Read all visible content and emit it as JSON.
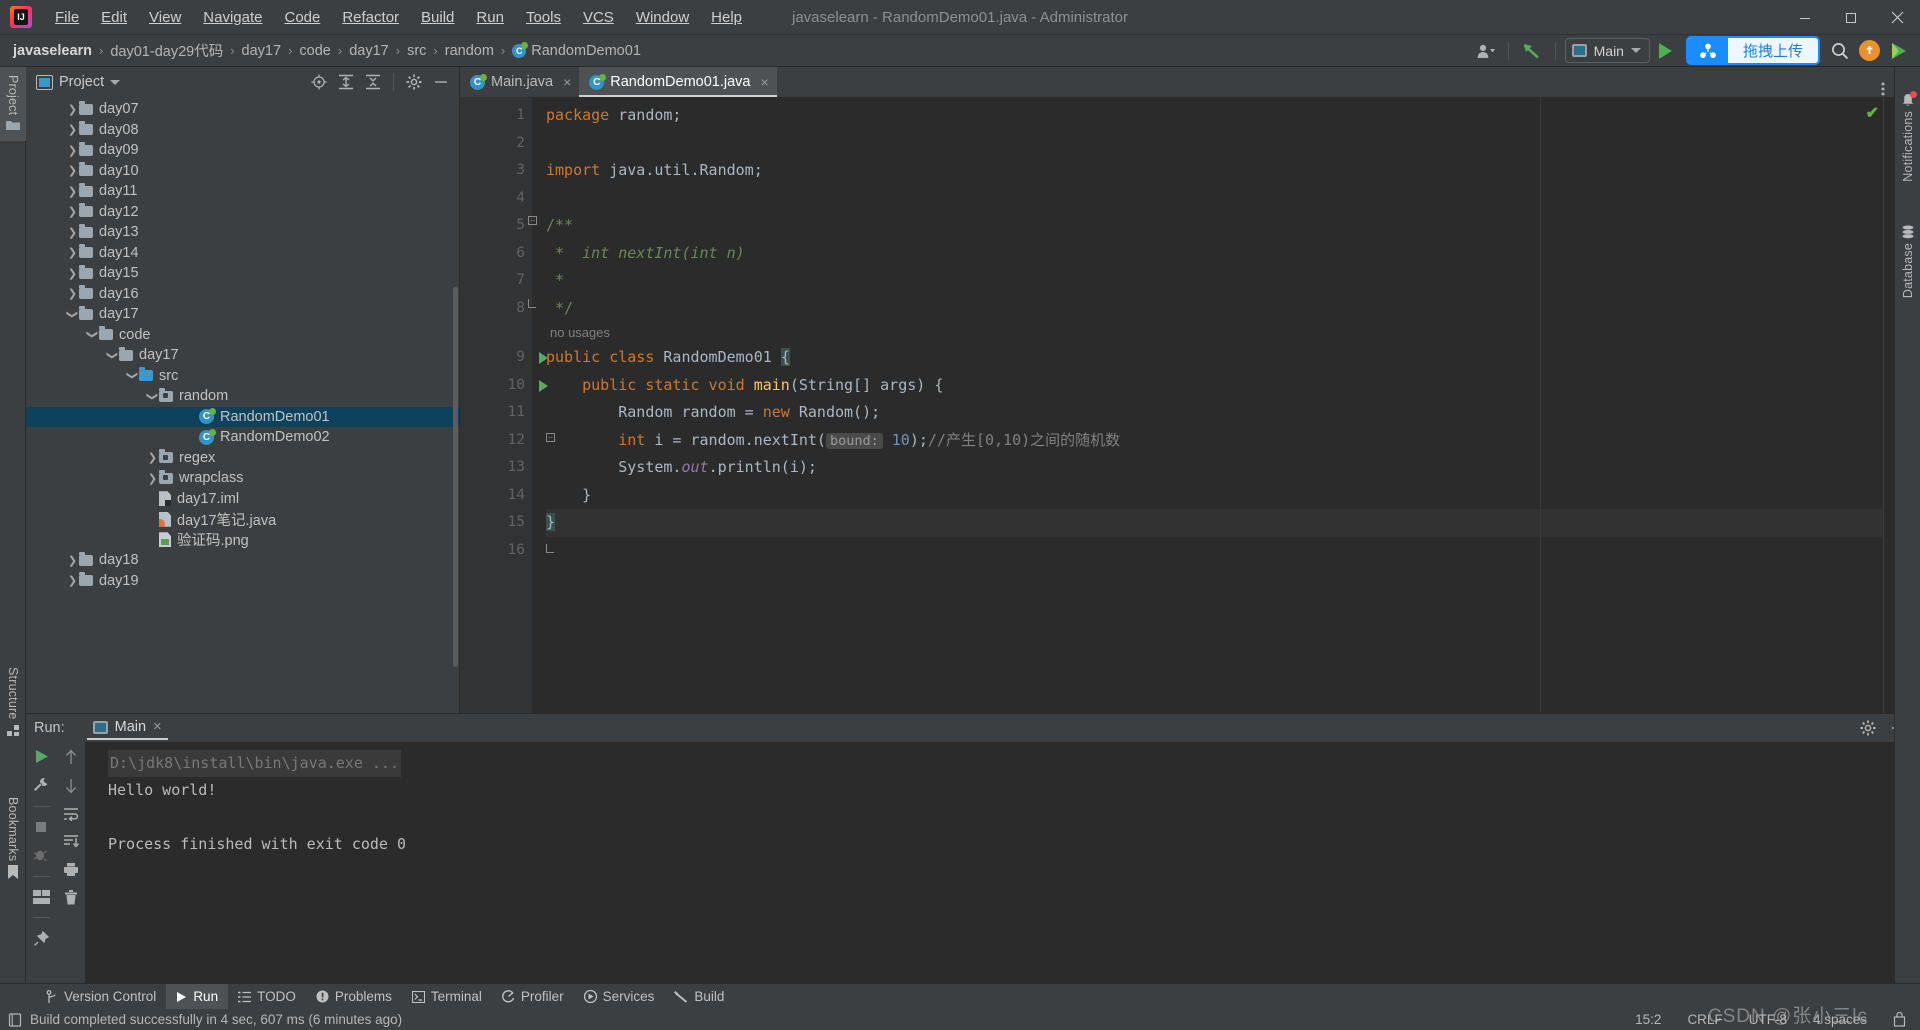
{
  "window": {
    "title": "javaselearn - RandomDemo01.java - Administrator",
    "minimize_label": "Minimize",
    "maximize_label": "Maximize",
    "close_label": "Close"
  },
  "menu": {
    "items": [
      {
        "label": "File",
        "mnemonic": "F"
      },
      {
        "label": "Edit",
        "mnemonic": "E"
      },
      {
        "label": "View",
        "mnemonic": "V"
      },
      {
        "label": "Navigate",
        "mnemonic": "N"
      },
      {
        "label": "Code",
        "mnemonic": "C"
      },
      {
        "label": "Refactor",
        "mnemonic": "R"
      },
      {
        "label": "Build",
        "mnemonic": "B"
      },
      {
        "label": "Run",
        "mnemonic": "u"
      },
      {
        "label": "Tools",
        "mnemonic": "T"
      },
      {
        "label": "VCS",
        "mnemonic": "S"
      },
      {
        "label": "Window",
        "mnemonic": "W"
      },
      {
        "label": "Help",
        "mnemonic": "H"
      }
    ]
  },
  "breadcrumb": {
    "items": [
      "javaselearn",
      "day01-day29代码",
      "day17",
      "code",
      "day17",
      "src",
      "random",
      "RandomDemo01"
    ],
    "separator": "›",
    "file_icon": "java-class-icon"
  },
  "toolbar": {
    "account_icon": "user-account-icon",
    "account_caret": "chevron-down-icon",
    "update_icon": "vcs-update-arrow-icon",
    "run_config": "Main",
    "run_config_caret": "chevron-down-icon",
    "run_button": "run-play-icon",
    "upload_label": "拖拽上传",
    "upload_icon": "cloud-share-icon",
    "search_icon": "search-icon",
    "notify_icon": "upload-arrow-icon",
    "ide_icon": "play-color-icon",
    "more_icon": "more-vertical-icon"
  },
  "left_strip": {
    "project_label": "Project",
    "project_icon": "folder-icon",
    "structure_label": "Structure",
    "structure_icon": "structure-icon",
    "bookmarks_label": "Bookmarks",
    "bookmarks_icon": "bookmark-icon"
  },
  "right_strip": {
    "notifications_label": "Notifications",
    "notifications_icon": "bell-icon",
    "database_label": "Database",
    "database_icon": "database-icon"
  },
  "project_panel": {
    "title": "Project",
    "title_caret": "chevron-down-icon",
    "icons": [
      "locate-icon",
      "expand-all-icon",
      "collapse-all-icon",
      "gear-icon",
      "hide-icon"
    ],
    "tree": [
      {
        "label": "day07",
        "indent": 2,
        "arrow": "collapsed",
        "icon": "folder"
      },
      {
        "label": "day08",
        "indent": 2,
        "arrow": "collapsed",
        "icon": "folder"
      },
      {
        "label": "day09",
        "indent": 2,
        "arrow": "collapsed",
        "icon": "folder"
      },
      {
        "label": "day10",
        "indent": 2,
        "arrow": "collapsed",
        "icon": "folder"
      },
      {
        "label": "day11",
        "indent": 2,
        "arrow": "collapsed",
        "icon": "folder"
      },
      {
        "label": "day12",
        "indent": 2,
        "arrow": "collapsed",
        "icon": "folder"
      },
      {
        "label": "day13",
        "indent": 2,
        "arrow": "collapsed",
        "icon": "folder"
      },
      {
        "label": "day14",
        "indent": 2,
        "arrow": "collapsed",
        "icon": "folder"
      },
      {
        "label": "day15",
        "indent": 2,
        "arrow": "collapsed",
        "icon": "folder"
      },
      {
        "label": "day16",
        "indent": 2,
        "arrow": "collapsed",
        "icon": "folder"
      },
      {
        "label": "day17",
        "indent": 2,
        "arrow": "expanded",
        "icon": "folder"
      },
      {
        "label": "code",
        "indent": 3,
        "arrow": "expanded",
        "icon": "folder"
      },
      {
        "label": "day17",
        "indent": 4,
        "arrow": "expanded",
        "icon": "folder"
      },
      {
        "label": "src",
        "indent": 5,
        "arrow": "expanded",
        "icon": "folder-blue"
      },
      {
        "label": "random",
        "indent": 6,
        "arrow": "expanded",
        "icon": "package"
      },
      {
        "label": "RandomDemo01",
        "indent": 8,
        "arrow": "none",
        "icon": "class",
        "selected": true
      },
      {
        "label": "RandomDemo02",
        "indent": 8,
        "arrow": "none",
        "icon": "class"
      },
      {
        "label": "regex",
        "indent": 6,
        "arrow": "collapsed",
        "icon": "package"
      },
      {
        "label": "wrapclass",
        "indent": 6,
        "arrow": "collapsed",
        "icon": "package"
      },
      {
        "label": "day17.iml",
        "indent": 6,
        "arrow": "none",
        "icon": "iml"
      },
      {
        "label": "day17笔记.java",
        "indent": 6,
        "arrow": "none",
        "icon": "java"
      },
      {
        "label": "验证码.png",
        "indent": 6,
        "arrow": "none",
        "icon": "png"
      },
      {
        "label": "day18",
        "indent": 2,
        "arrow": "collapsed",
        "icon": "folder"
      },
      {
        "label": "day19",
        "indent": 2,
        "arrow": "collapsed",
        "icon": "folder"
      }
    ]
  },
  "editor": {
    "tabs": [
      {
        "label": "Main.java",
        "icon": "java-class-icon",
        "active": false,
        "close": "×"
      },
      {
        "label": "RandomDemo01.java",
        "icon": "java-class-icon",
        "active": true,
        "close": "×"
      }
    ],
    "more_icon": "more-vertical-icon",
    "inspection_status": "✔",
    "usages_hint": "no usages",
    "line_numbers": [
      "1",
      "2",
      "3",
      "4",
      "5",
      "6",
      "7",
      "8",
      "9",
      "10",
      "11",
      "12",
      "13",
      "14",
      "15",
      "16"
    ],
    "code_lines": [
      {
        "n": 1,
        "text": "package random;"
      },
      {
        "n": 2,
        "text": ""
      },
      {
        "n": 3,
        "text": "import java.util.Random;"
      },
      {
        "n": 4,
        "text": ""
      },
      {
        "n": 5,
        "text": "/**"
      },
      {
        "n": 6,
        "text": " *  int nextInt(int n)"
      },
      {
        "n": 7,
        "text": " *"
      },
      {
        "n": 8,
        "text": " */"
      },
      {
        "n": 9,
        "text": "public class RandomDemo01 {"
      },
      {
        "n": 10,
        "text": "    public static void main(String[] args) {"
      },
      {
        "n": 11,
        "text": "        Random random = new Random();"
      },
      {
        "n": 12,
        "text": "        int i = random.nextInt( bound: 10);//产生[0,10)之间的随机数"
      },
      {
        "n": 13,
        "text": "        System.out.println(i);"
      },
      {
        "n": 14,
        "text": "    }"
      },
      {
        "n": 15,
        "text": "}"
      },
      {
        "n": 16,
        "text": ""
      }
    ],
    "inlay_hint": "bound:",
    "comment_line12": "//产生[0,10)之间的随机数"
  },
  "run_panel": {
    "label": "Run:",
    "tab": "Main",
    "tab_icon": "run-config-icon",
    "tab_close": "×",
    "settings_icon": "gear-icon",
    "minimize_icon": "minimize-icon",
    "tool_icons_left": [
      "rerun-icon",
      "wrench-icon",
      "stop-icon",
      "debug-icon",
      "layout-icon",
      "pin-icon"
    ],
    "tool_icons_right": [
      "up-arrow-icon",
      "down-arrow-icon",
      "soft-wrap-icon",
      "scroll-end-icon",
      "print-icon",
      "trash-icon"
    ],
    "console": [
      {
        "text": "D:\\jdk8\\install\\bin\\java.exe ...",
        "style": "command"
      },
      {
        "text": "Hello world!",
        "style": "normal"
      },
      {
        "text": "",
        "style": "normal"
      },
      {
        "text": "Process finished with exit code 0",
        "style": "normal"
      }
    ]
  },
  "bottom_bar": {
    "items": [
      {
        "label": "Version Control",
        "icon": "branch-icon",
        "active": false
      },
      {
        "label": "Run",
        "icon": "play-icon",
        "active": true
      },
      {
        "label": "TODO",
        "icon": "todo-list-icon",
        "active": false
      },
      {
        "label": "Problems",
        "icon": "warning-icon",
        "active": false
      },
      {
        "label": "Terminal",
        "icon": "terminal-icon",
        "active": false
      },
      {
        "label": "Profiler",
        "icon": "profiler-icon",
        "active": false
      },
      {
        "label": "Services",
        "icon": "services-icon",
        "active": false
      },
      {
        "label": "Build",
        "icon": "build-hammer-icon",
        "active": false
      }
    ]
  },
  "status_bar": {
    "message": "Build completed successfully in 4 sec, 607 ms (6 minutes ago)",
    "message_icon": "event-log-icon",
    "caret_position": "15:2",
    "line_separator": "CRLF",
    "encoding": "UTF-8",
    "indent": "4 spaces",
    "lock_icon": "read-only-toggle-icon",
    "watermark": "CSDN @张小三lc"
  },
  "colors": {
    "background": "#3c3f41",
    "editor_background": "#2b2b2b",
    "selection": "#0d425d",
    "accent_blue": "#1a8cff",
    "green_run": "#59a869",
    "keyword_orange": "#cc7832",
    "string_green": "#6a8759",
    "number_blue": "#6897bb",
    "method_yellow": "#ffc66d",
    "field_purple": "#9876aa"
  }
}
